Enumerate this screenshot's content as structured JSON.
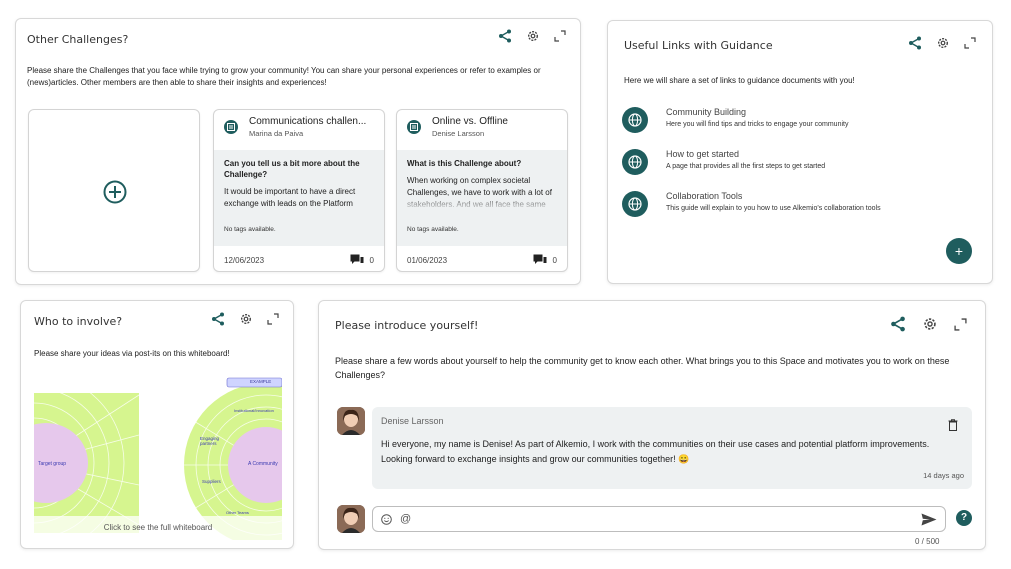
{
  "challenges_card": {
    "title": "Other Challenges?",
    "description": "Please share the Challenges that you face while trying to grow your community! You can share your personal experiences or refer to examples or (news)articles. Other members are then able to share their insights and experiences!",
    "posts": [
      {
        "title": "Communications challen...",
        "author": "Marina da Paiva",
        "question": "Can you tell us a bit more about the Challenge?",
        "text": "It would be important to have a direct exchange with leads on the Platform",
        "tags": "No tags available.",
        "date": "12/06/2023",
        "comments": "0"
      },
      {
        "title": "Online vs. Offline",
        "author": "Denise Larsson",
        "question": "What is this Challenge about?",
        "text": "When working on complex societal Challenges, we have to work with a lot of stakeholders. And we all face the same",
        "tags": "No tags available.",
        "date": "01/06/2023",
        "comments": "0"
      }
    ]
  },
  "links_card": {
    "title": "Useful Links with Guidance",
    "description": "Here we will share a set of links to guidance documents with you!",
    "links": [
      {
        "title": "Community Building",
        "desc": "Here you will find tips and tricks to engage your community"
      },
      {
        "title": "How to get started",
        "desc": "A page that provides all the first steps to get started"
      },
      {
        "title": "Collaboration Tools",
        "desc": "This guide will explain to you how to use Alkemio's collaboration tools"
      }
    ],
    "add_label": "+"
  },
  "whiteboard_card": {
    "title": "Who to involve?",
    "description": "Please share your ideas via post-its on this whiteboard!",
    "caption": "Click to see the full whiteboard",
    "labels": {
      "example": "EXAMPLE",
      "target": "Target group",
      "community": "A Community",
      "engaging": "Engaging partners",
      "suppliers": "Suppliers",
      "institutional": "Institutional/Innovation",
      "other": "Other Teams"
    }
  },
  "intro_card": {
    "title": "Please introduce yourself!",
    "description": "Please share a few words about yourself to help the community get to know each other. What brings you to this Space and motivates you to work on these Challenges?",
    "comment": {
      "author": "Denise Larsson",
      "text": "Hi everyone, my name is Denise! As part of Alkemio, I work with the communities on their use cases and potential platform improvements. Looking forward to exchange insights and grow our communities together! 😀",
      "time": "14 days ago"
    },
    "input_counter": "0 / 500",
    "help": "?"
  },
  "colors": {
    "brand": "#1f5d5e",
    "wb_green": "#d6f58f",
    "wb_pink": "#e6c8ec"
  }
}
